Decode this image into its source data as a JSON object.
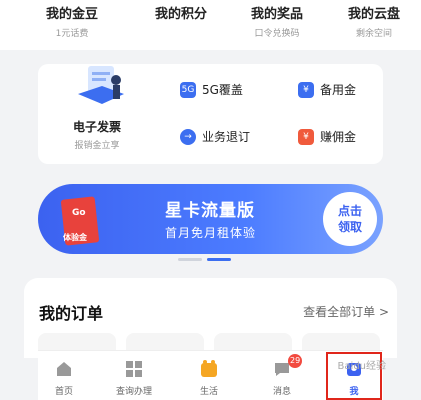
{
  "stats": [
    {
      "title": "我的金豆",
      "sub": "1元话费"
    },
    {
      "title": "我的积分",
      "sub": ""
    },
    {
      "title": "我的奖品",
      "sub": "口令兑换码"
    },
    {
      "title": "我的云盘",
      "sub": "剩余空间"
    }
  ],
  "services": {
    "invoice": {
      "title": "电子发票",
      "sub": "报销金立享"
    },
    "items": [
      {
        "label": "5G覆盖",
        "icon": "5g-icon",
        "color": "#3c6ef0"
      },
      {
        "label": "备用金",
        "icon": "reserve-fund-icon",
        "color": "#3c6ef0"
      },
      {
        "label": "业务退订",
        "icon": "unsubscribe-icon",
        "color": "#3c6ef0"
      },
      {
        "label": "赚佣金",
        "icon": "commission-icon",
        "color": "#f05a3c"
      }
    ]
  },
  "banner": {
    "title": "星卡流量版",
    "subtitle": "首月免月租体验",
    "button": "点击\n领取",
    "tag": "体验金",
    "tag_go": "Go"
  },
  "orders": {
    "title": "我的订单",
    "view_all": "查看全部订单 >"
  },
  "tabbar": {
    "items": [
      {
        "label": "首页"
      },
      {
        "label": "查询办理"
      },
      {
        "label": "生活"
      },
      {
        "label": "消息",
        "badge": "29"
      },
      {
        "label": "我"
      }
    ],
    "active_index": 4
  },
  "watermark": "Baidu经验"
}
